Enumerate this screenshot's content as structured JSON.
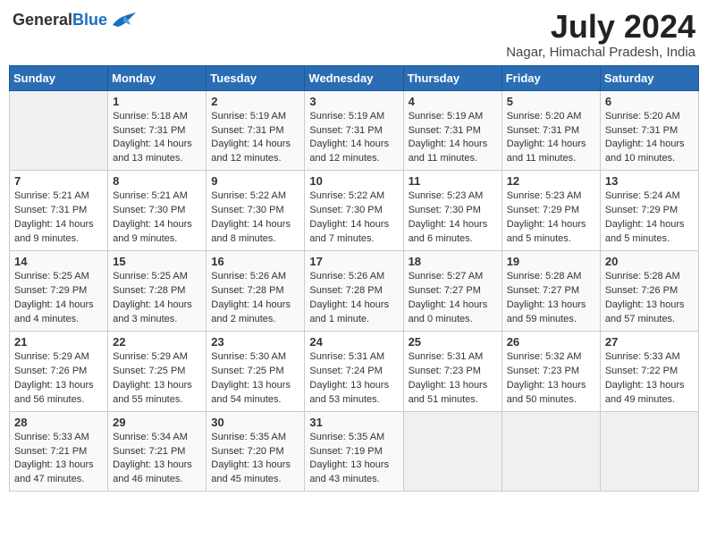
{
  "header": {
    "logo_general": "General",
    "logo_blue": "Blue",
    "month": "July 2024",
    "location": "Nagar, Himachal Pradesh, India"
  },
  "weekdays": [
    "Sunday",
    "Monday",
    "Tuesday",
    "Wednesday",
    "Thursday",
    "Friday",
    "Saturday"
  ],
  "weeks": [
    [
      {
        "day": "",
        "info": ""
      },
      {
        "day": "1",
        "info": "Sunrise: 5:18 AM\nSunset: 7:31 PM\nDaylight: 14 hours\nand 13 minutes."
      },
      {
        "day": "2",
        "info": "Sunrise: 5:19 AM\nSunset: 7:31 PM\nDaylight: 14 hours\nand 12 minutes."
      },
      {
        "day": "3",
        "info": "Sunrise: 5:19 AM\nSunset: 7:31 PM\nDaylight: 14 hours\nand 12 minutes."
      },
      {
        "day": "4",
        "info": "Sunrise: 5:19 AM\nSunset: 7:31 PM\nDaylight: 14 hours\nand 11 minutes."
      },
      {
        "day": "5",
        "info": "Sunrise: 5:20 AM\nSunset: 7:31 PM\nDaylight: 14 hours\nand 11 minutes."
      },
      {
        "day": "6",
        "info": "Sunrise: 5:20 AM\nSunset: 7:31 PM\nDaylight: 14 hours\nand 10 minutes."
      }
    ],
    [
      {
        "day": "7",
        "info": "Sunrise: 5:21 AM\nSunset: 7:31 PM\nDaylight: 14 hours\nand 9 minutes."
      },
      {
        "day": "8",
        "info": "Sunrise: 5:21 AM\nSunset: 7:30 PM\nDaylight: 14 hours\nand 9 minutes."
      },
      {
        "day": "9",
        "info": "Sunrise: 5:22 AM\nSunset: 7:30 PM\nDaylight: 14 hours\nand 8 minutes."
      },
      {
        "day": "10",
        "info": "Sunrise: 5:22 AM\nSunset: 7:30 PM\nDaylight: 14 hours\nand 7 minutes."
      },
      {
        "day": "11",
        "info": "Sunrise: 5:23 AM\nSunset: 7:30 PM\nDaylight: 14 hours\nand 6 minutes."
      },
      {
        "day": "12",
        "info": "Sunrise: 5:23 AM\nSunset: 7:29 PM\nDaylight: 14 hours\nand 5 minutes."
      },
      {
        "day": "13",
        "info": "Sunrise: 5:24 AM\nSunset: 7:29 PM\nDaylight: 14 hours\nand 5 minutes."
      }
    ],
    [
      {
        "day": "14",
        "info": "Sunrise: 5:25 AM\nSunset: 7:29 PM\nDaylight: 14 hours\nand 4 minutes."
      },
      {
        "day": "15",
        "info": "Sunrise: 5:25 AM\nSunset: 7:28 PM\nDaylight: 14 hours\nand 3 minutes."
      },
      {
        "day": "16",
        "info": "Sunrise: 5:26 AM\nSunset: 7:28 PM\nDaylight: 14 hours\nand 2 minutes."
      },
      {
        "day": "17",
        "info": "Sunrise: 5:26 AM\nSunset: 7:28 PM\nDaylight: 14 hours\nand 1 minute."
      },
      {
        "day": "18",
        "info": "Sunrise: 5:27 AM\nSunset: 7:27 PM\nDaylight: 14 hours\nand 0 minutes."
      },
      {
        "day": "19",
        "info": "Sunrise: 5:28 AM\nSunset: 7:27 PM\nDaylight: 13 hours\nand 59 minutes."
      },
      {
        "day": "20",
        "info": "Sunrise: 5:28 AM\nSunset: 7:26 PM\nDaylight: 13 hours\nand 57 minutes."
      }
    ],
    [
      {
        "day": "21",
        "info": "Sunrise: 5:29 AM\nSunset: 7:26 PM\nDaylight: 13 hours\nand 56 minutes."
      },
      {
        "day": "22",
        "info": "Sunrise: 5:29 AM\nSunset: 7:25 PM\nDaylight: 13 hours\nand 55 minutes."
      },
      {
        "day": "23",
        "info": "Sunrise: 5:30 AM\nSunset: 7:25 PM\nDaylight: 13 hours\nand 54 minutes."
      },
      {
        "day": "24",
        "info": "Sunrise: 5:31 AM\nSunset: 7:24 PM\nDaylight: 13 hours\nand 53 minutes."
      },
      {
        "day": "25",
        "info": "Sunrise: 5:31 AM\nSunset: 7:23 PM\nDaylight: 13 hours\nand 51 minutes."
      },
      {
        "day": "26",
        "info": "Sunrise: 5:32 AM\nSunset: 7:23 PM\nDaylight: 13 hours\nand 50 minutes."
      },
      {
        "day": "27",
        "info": "Sunrise: 5:33 AM\nSunset: 7:22 PM\nDaylight: 13 hours\nand 49 minutes."
      }
    ],
    [
      {
        "day": "28",
        "info": "Sunrise: 5:33 AM\nSunset: 7:21 PM\nDaylight: 13 hours\nand 47 minutes."
      },
      {
        "day": "29",
        "info": "Sunrise: 5:34 AM\nSunset: 7:21 PM\nDaylight: 13 hours\nand 46 minutes."
      },
      {
        "day": "30",
        "info": "Sunrise: 5:35 AM\nSunset: 7:20 PM\nDaylight: 13 hours\nand 45 minutes."
      },
      {
        "day": "31",
        "info": "Sunrise: 5:35 AM\nSunset: 7:19 PM\nDaylight: 13 hours\nand 43 minutes."
      },
      {
        "day": "",
        "info": ""
      },
      {
        "day": "",
        "info": ""
      },
      {
        "day": "",
        "info": ""
      }
    ]
  ]
}
